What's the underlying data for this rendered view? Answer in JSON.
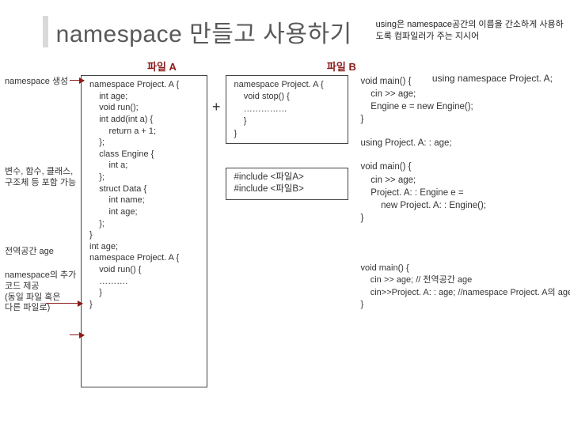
{
  "title": "namespace 만들고 사용하기",
  "using_note": "using은 namespace공간의 이름을 간소하게\n사용하도록 컴파일러가 주는 지시어",
  "header_a": "파일 A",
  "header_b": "파일 B",
  "using_namespace_line": "using namespace Project. A;",
  "leftnotes": {
    "create": "namespace 생성",
    "includes": "변수, 함수, 클래스,\n구조체 등 포함 가능",
    "global": "전역공간 age",
    "addcode": "namespace의 추가\n코드 제공\n(동일 파일 혹은\n다른 파일로)"
  },
  "file_a_code": "namespace Project. A {\n    int age;\n    void run();\n    int add(int a) {\n        return a + 1;\n    };\n    class Engine {\n        int a;\n    };\n    struct Data {\n        int name;\n        int age;\n    };\n}\nint age;\nnamespace Project. A {\n    void run() {\n    ……….\n    }\n}",
  "plus": "+",
  "file_b_code": "namespace Project. A {\n    void stop() {\n    ……………\n    }\n}",
  "include_code": "#include <파일A>\n#include <파일B>",
  "right_blocks": {
    "b1": "void main() {\n    cin >> age;\n    Engine e = new Engine();\n}",
    "b2": "using Project. A: : age;",
    "b3": "void main() {\n    cin >> age;\n    Project. A: : Engine e =\n        new Project. A: : Engine();\n}",
    "b4": "void main() {\n    cin >> age; // 전역공간 age\n    cin>>Project. A: : age; //namespace Project. A의 age\n}"
  }
}
